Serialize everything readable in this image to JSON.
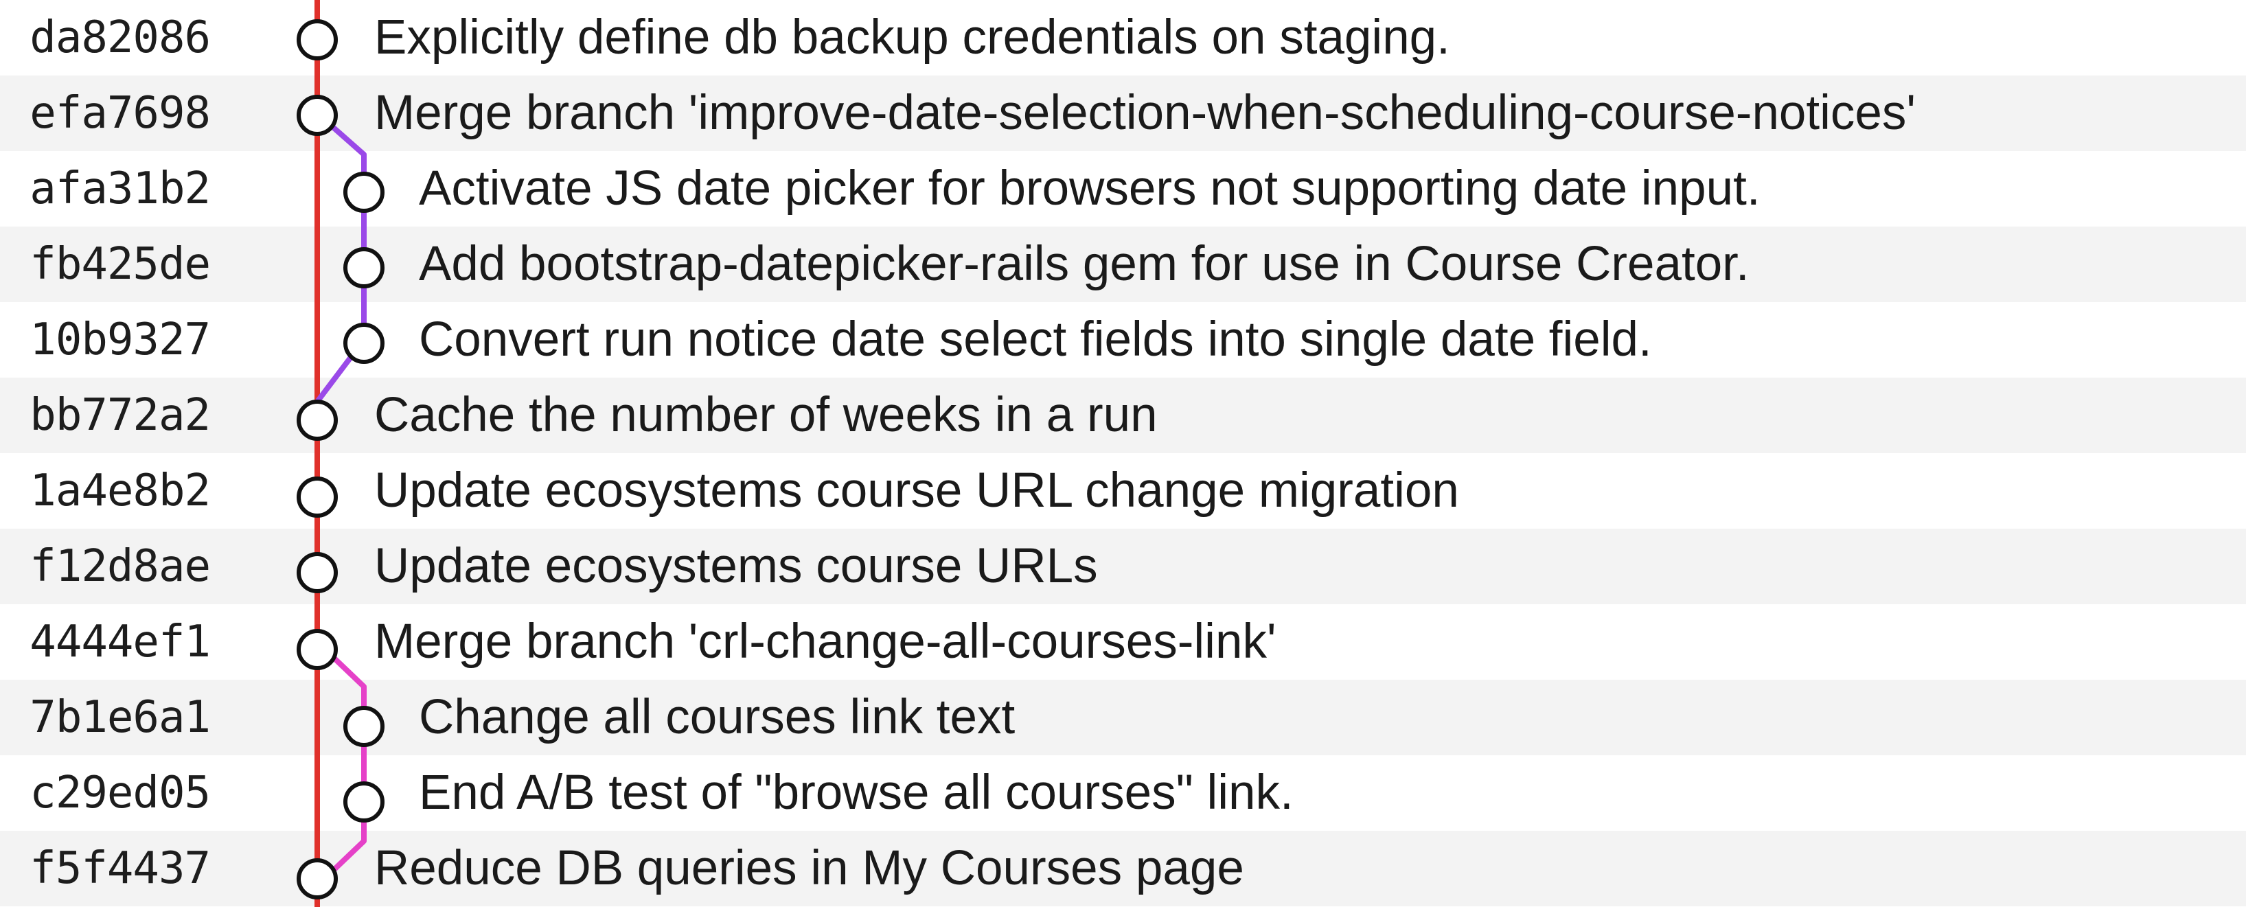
{
  "colors": {
    "main_line": "#e0312b",
    "branch_improve_date": "#9a49e8",
    "branch_crl": "#e541c8",
    "row_alt_bg": "#f3f3f3",
    "node_stroke": "#111111"
  },
  "commits": [
    {
      "hash": "da82086",
      "message": "Explicitly define db backup credentials on staging.",
      "lane": "main"
    },
    {
      "hash": "efa7698",
      "message": "Merge branch 'improve-date-selection-when-scheduling-course-notices'",
      "lane": "main"
    },
    {
      "hash": "afa31b2",
      "message": "Activate JS date picker for browsers not supporting date input.",
      "lane": "side"
    },
    {
      "hash": "fb425de",
      "message": "Add bootstrap-datepicker-rails gem for use in Course Creator.",
      "lane": "side"
    },
    {
      "hash": "10b9327",
      "message": "Convert run notice date select fields into single date field.",
      "lane": "side"
    },
    {
      "hash": "bb772a2",
      "message": "Cache the number of weeks in a run",
      "lane": "main"
    },
    {
      "hash": "1a4e8b2",
      "message": "Update ecosystems course URL change migration",
      "lane": "main"
    },
    {
      "hash": "f12d8ae",
      "message": "Update ecosystems course URLs",
      "lane": "main"
    },
    {
      "hash": "4444ef1",
      "message": "Merge branch 'crl-change-all-courses-link'",
      "lane": "main"
    },
    {
      "hash": "7b1e6a1",
      "message": "Change all courses link text",
      "lane": "side"
    },
    {
      "hash": "c29ed05",
      "message": "End A/B test of \"browse all courses\" link.",
      "lane": "side"
    },
    {
      "hash": "f5f4437",
      "message": "Reduce DB queries in My Courses page",
      "lane": "main"
    }
  ]
}
